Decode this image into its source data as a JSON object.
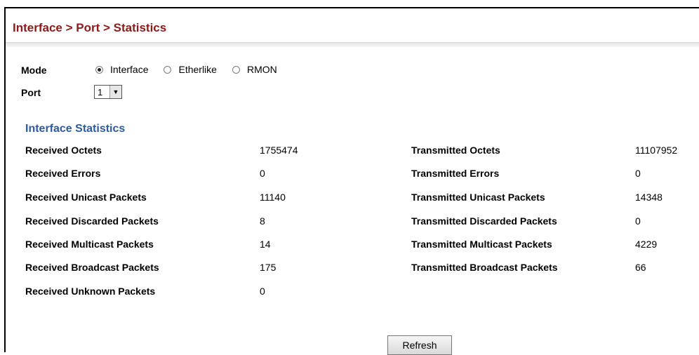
{
  "header": {
    "title": "Interface > Port > Statistics"
  },
  "mode": {
    "label": "Mode",
    "options": [
      {
        "label": "Interface",
        "selected": true
      },
      {
        "label": "Etherlike",
        "selected": false
      },
      {
        "label": "RMON",
        "selected": false
      }
    ]
  },
  "port": {
    "label": "Port",
    "selected": "1"
  },
  "stats": {
    "heading": "Interface Statistics",
    "rows": [
      {
        "rx_label": "Received Octets",
        "rx_value": "1755474",
        "tx_label": "Transmitted Octets",
        "tx_value": "11107952"
      },
      {
        "rx_label": "Received Errors",
        "rx_value": "0",
        "tx_label": "Transmitted Errors",
        "tx_value": "0"
      },
      {
        "rx_label": "Received Unicast Packets",
        "rx_value": "11140",
        "tx_label": "Transmitted Unicast Packets",
        "tx_value": "14348"
      },
      {
        "rx_label": "Received Discarded Packets",
        "rx_value": "8",
        "tx_label": "Transmitted Discarded Packets",
        "tx_value": "0"
      },
      {
        "rx_label": "Received Multicast Packets",
        "rx_value": "14",
        "tx_label": "Transmitted Multicast Packets",
        "tx_value": "4229"
      },
      {
        "rx_label": "Received Broadcast Packets",
        "rx_value": "175",
        "tx_label": "Transmitted Broadcast Packets",
        "tx_value": "66"
      },
      {
        "rx_label": "Received Unknown Packets",
        "rx_value": "0",
        "tx_label": "",
        "tx_value": ""
      }
    ]
  },
  "actions": {
    "refresh_label": "Refresh"
  },
  "colors": {
    "title": "#8b1a1a",
    "section_heading": "#2d5aa0"
  },
  "icons": {
    "select_arrow": "chevron-down-icon"
  }
}
